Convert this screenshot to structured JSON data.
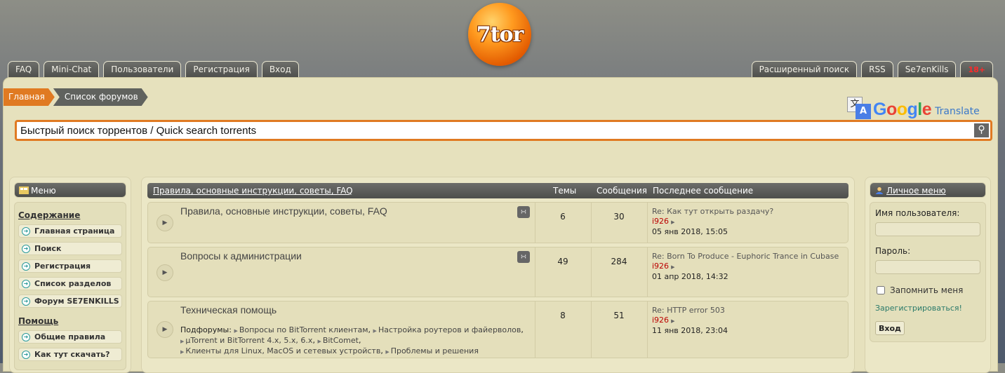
{
  "logo": {
    "text": "7tor"
  },
  "nav_left": [
    {
      "label": "FAQ"
    },
    {
      "label": "Mini-Chat"
    },
    {
      "label": "Пользователи"
    },
    {
      "label": "Регистрация"
    },
    {
      "label": "Вход"
    }
  ],
  "nav_right": [
    {
      "label": "Расширенный поиск"
    },
    {
      "label": "RSS"
    },
    {
      "label": "Se7enKills"
    },
    {
      "label": "18+"
    }
  ],
  "breadcrumb": {
    "home": "Главная",
    "forums": "Список форумов"
  },
  "google_translate": {
    "word": "Google",
    "suffix": "Translate"
  },
  "search": {
    "value": "Быстрый поиск торрентов / Quick search torrents"
  },
  "left_menu": {
    "title": "Меню",
    "section1": "Содержание",
    "items1": [
      "Главная страница",
      "Поиск",
      "Регистрация",
      "Список разделов",
      "Форум SE7ENKILLS"
    ],
    "section2": "Помощь",
    "items2": [
      "Общие правила",
      "Как тут скачать?"
    ]
  },
  "forum_table": {
    "header": {
      "forum": "Правила, основные инструкции, советы, FAQ",
      "topics": "Темы",
      "posts": "Сообщения",
      "last": "Последнее сообщение"
    },
    "rows": [
      {
        "title": "Правила, основные инструкции, советы, FAQ",
        "topics": "6",
        "posts": "30",
        "last_title": "Re: Как тут открыть раздачу?",
        "last_user": "i926",
        "last_date": "05 янв 2018, 15:05"
      },
      {
        "title": "Вопросы к администрации",
        "topics": "49",
        "posts": "284",
        "last_title": "Re: Born To Produce - Euphoric Trance in Cubase",
        "last_user": "i926",
        "last_date": "01 апр 2018, 14:32"
      },
      {
        "title": "Техническая помощь",
        "topics": "8",
        "posts": "51",
        "last_title": "Re: HTTP error 503",
        "last_user": "i926",
        "last_date": "11 янв 2018, 23:04",
        "subforums_label": "Подфорумы:",
        "subforums": [
          "Вопросы по BitTorrent клиентам",
          "Настройка роутеров и файерволов",
          "μTorrent и BitTorrent 4.x, 5.x, 6.x",
          "BitComet",
          "Клиенты для Linux, MacOS и сетевых устройств",
          "Проблемы и решения"
        ]
      }
    ]
  },
  "right_menu": {
    "title": "Личное меню",
    "username_label": "Имя пользователя:",
    "password_label": "Пароль:",
    "remember_label": "Запомнить меня",
    "register_link": "Зарегистрироваться!",
    "login_button": "Вход"
  }
}
